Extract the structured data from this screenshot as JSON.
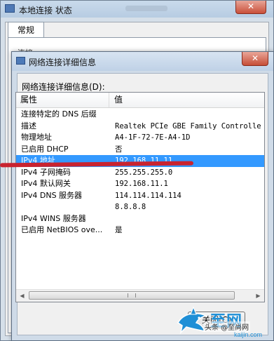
{
  "background_window": {
    "title": "本地连接 状态",
    "tab_general": "常规",
    "peek_text": "连接"
  },
  "dialog": {
    "title": "网络连接详细信息",
    "close_glyph": "✕",
    "list_label": "网络连接详细信息(D):",
    "columns": {
      "property": "属性",
      "value": "值"
    },
    "rows": [
      {
        "property": "连接特定的 DNS 后缀",
        "value": ""
      },
      {
        "property": "描述",
        "value": "Realtek PCIe GBE Family Controlle"
      },
      {
        "property": "物理地址",
        "value": "A4-1F-72-7E-A4-1D"
      },
      {
        "property": "已启用 DHCP",
        "value": "否"
      },
      {
        "property": "IPv4 地址",
        "value": "192.168.11.11"
      },
      {
        "property": "IPv4 子网掩码",
        "value": "255.255.255.0"
      },
      {
        "property": "IPv4 默认网关",
        "value": "192.168.11.1"
      },
      {
        "property": "IPv4 DNS 服务器",
        "value": "114.114.114.114"
      },
      {
        "property": "",
        "value": "8.8.8.8"
      },
      {
        "property": "IPv4 WINS 服务器",
        "value": ""
      },
      {
        "property": "已启用 NetBIOS ove...",
        "value": "是"
      }
    ],
    "selected_row": 4,
    "close_button": "关闭(C)"
  },
  "watermark": {
    "brand": "至网",
    "source": "头条 @至尚网",
    "domain": "kaijin.com"
  },
  "colors": {
    "selection": "#3399ff",
    "annotation": "#c9232f",
    "watermark": "#1f8fd6"
  }
}
